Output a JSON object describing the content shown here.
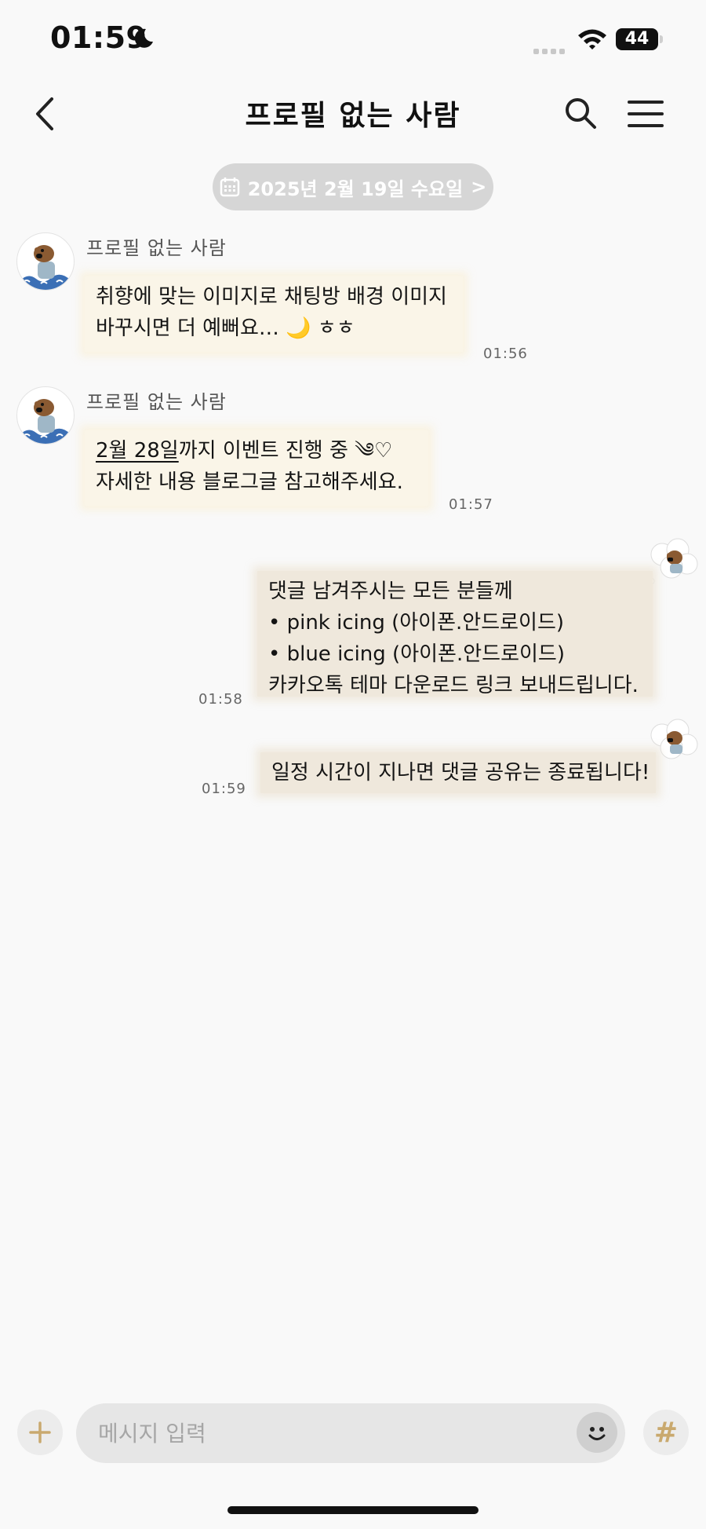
{
  "status_bar": {
    "time": "01:59",
    "battery": "44"
  },
  "header": {
    "title": "프로필 없는 사람"
  },
  "date_divider": {
    "label": "2025년 2월 19일 수요일",
    "chevron": ">"
  },
  "messages": [
    {
      "sender": "프로필 없는 사람",
      "lines": [
        "취향에 맞는 이미지로 채팅방 배경 이미지",
        "바꾸시면 더 예뻐요… 🌙 ㅎㅎ"
      ],
      "time": "01:56"
    },
    {
      "sender": "프로필 없는 사람",
      "lines": [
        "2월 28일",
        "까지 이벤트 진행 중 ༄♡",
        "자세한 내용 블로그글 참고해주세요."
      ],
      "time": "01:57"
    },
    {
      "lines": [
        "댓글 남겨주시는 모든 분들께",
        " • pink icing (아이폰.안드로이드)",
        " • blue icing (아이폰.안드로이드)",
        "카카오톡 테마 다운로드 링크 보내드립니다."
      ],
      "time": "01:58"
    },
    {
      "lines": [
        "일정 시간이 지나면 댓글 공유는 종료됩니다!"
      ],
      "time": "01:59"
    }
  ],
  "input_bar": {
    "placeholder": "메시지 입력",
    "plus": "+",
    "hash": "#"
  },
  "colors": {
    "background": "#f9f9f9",
    "bubble_other": "#faf5e8",
    "bubble_mine": "#efe8dc",
    "hash_accent": "#c9a96e"
  }
}
